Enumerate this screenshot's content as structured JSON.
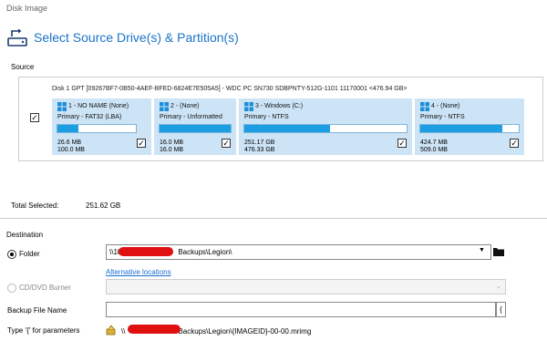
{
  "window": {
    "title": "Disk Image"
  },
  "header": {
    "title": "Select Source Drive(s) & Partition(s)",
    "icon": "disk-image-icon"
  },
  "source": {
    "label": "Source",
    "disk": {
      "title": "Disk 1 GPT [09267BF7-0B50-4AEF-BFED-6824E7E505A5] - WDC PC SN730 SDBPNTY-512G-1101 11170001  <476.94 GB>",
      "checked": true
    },
    "partitions": [
      {
        "name": "1 - NO NAME (None)",
        "type": "Primary - FAT32 (LBA)",
        "used": "26.6 MB",
        "total": "100.0 MB",
        "fill": 0.27,
        "checked": true
      },
      {
        "name": "2 - (None)",
        "type": "Primary - Unformatted",
        "used": "16.0 MB",
        "total": "16.0 MB",
        "fill": 1.0,
        "checked": true
      },
      {
        "name": "3 - Windows (C:)",
        "type": "Primary - NTFS",
        "used": "251.17 GB",
        "total": "476.33 GB",
        "fill": 0.53,
        "checked": true
      },
      {
        "name": "4 - (None)",
        "type": "Primary - NTFS",
        "used": "424.7 MB",
        "total": "509.0 MB",
        "fill": 0.83,
        "checked": true
      }
    ]
  },
  "total_selected": {
    "label": "Total Selected:",
    "value": "251.62 GB"
  },
  "destination": {
    "label": "Destination",
    "folder_option": {
      "label": "Folder",
      "selected": true
    },
    "folder_path_start": "\\\\10",
    "folder_path_end": "Backups\\Legion\\",
    "alternative_link": "Alternative locations",
    "cd_option": {
      "label": "CD/DVD Burner",
      "selected": false,
      "enabled": false
    },
    "backup_file_name": {
      "label": "Backup File Name",
      "value": "",
      "brace_button": "{"
    },
    "parameters": {
      "label": "Type '{' for parameters",
      "path_start": "\\\\",
      "path_end": "Backups\\Legion\\{IMAGEID}-00-00.mrimg"
    }
  },
  "colors": {
    "accent": "#1a73c9",
    "partition_bg": "#cde4f6",
    "bar_fill": "#1c9ee3",
    "redaction": "#e01010"
  }
}
